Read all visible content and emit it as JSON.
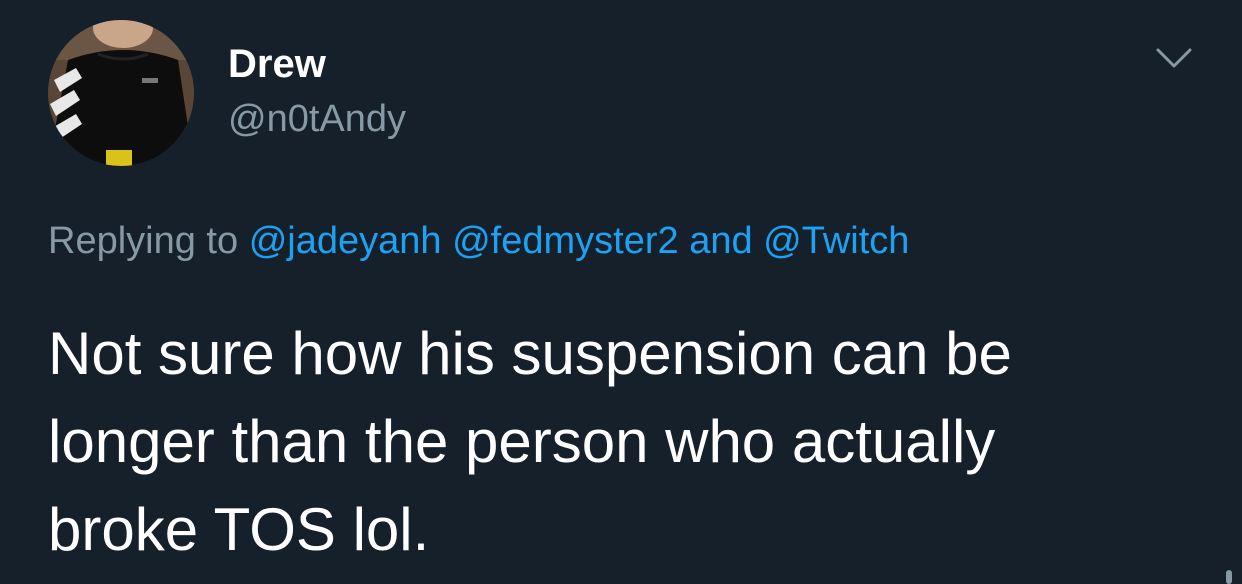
{
  "tweet": {
    "author_name": "Drew",
    "author_handle": "@n0tAndy",
    "avatar_icon": "profile-photo",
    "reply": {
      "prefix": "Replying to",
      "mention_1": "@jadeyanh",
      "mention_2": "@fedmyster2",
      "joiner": "and",
      "mention_3": "@Twitch"
    },
    "text_lines": [
      "Not sure how his suspension can be",
      "longer than the person who actually",
      "broke TOS lol."
    ],
    "menu_icon": "chevron-down-icon"
  },
  "colors": {
    "background": "#15202b",
    "primary_text": "#ffffff",
    "secondary_text": "#8899a6",
    "link": "#1da1f2"
  }
}
